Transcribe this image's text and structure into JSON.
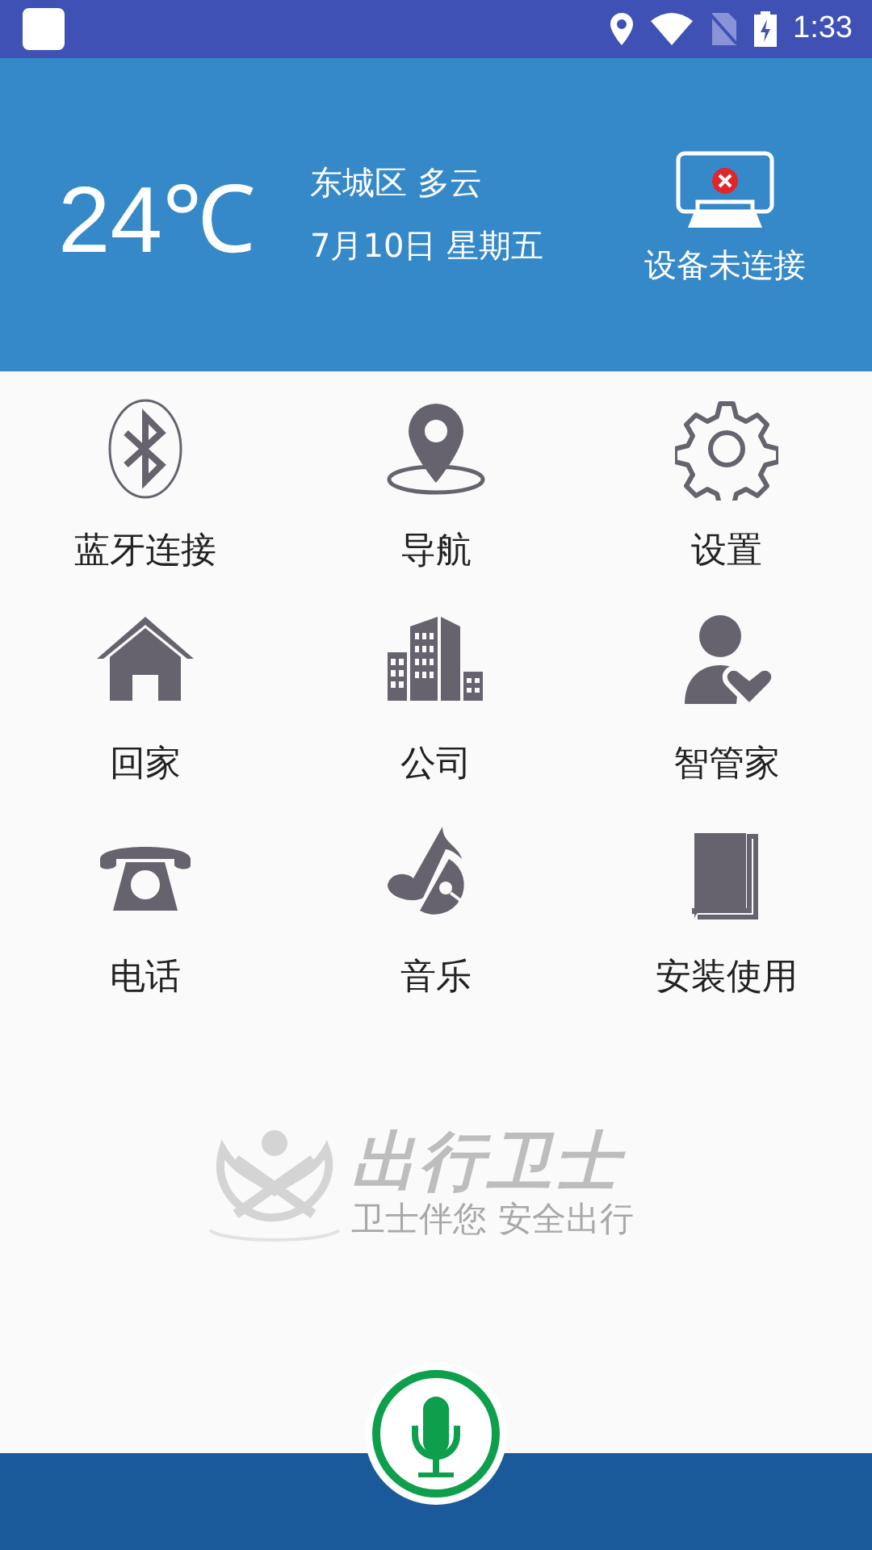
{
  "status_bar": {
    "time": "1:33"
  },
  "weather": {
    "temperature": "24℃",
    "location": "东城区 多云",
    "date": "7月10日 星期五"
  },
  "device": {
    "status": "设备未连接",
    "connected": false
  },
  "menu": [
    {
      "label": "蓝牙连接",
      "kind": "bluetooth"
    },
    {
      "label": "导航",
      "kind": "navigation"
    },
    {
      "label": "设置",
      "kind": "settings"
    },
    {
      "label": "回家",
      "kind": "home"
    },
    {
      "label": "公司",
      "kind": "office"
    },
    {
      "label": "智管家",
      "kind": "butler"
    },
    {
      "label": "电话",
      "kind": "phone"
    },
    {
      "label": "音乐",
      "kind": "music"
    },
    {
      "label": "安装使用",
      "kind": "manual"
    }
  ],
  "brand": {
    "name": "出行卫士",
    "slogan": "卫士伴您 安全出行"
  }
}
